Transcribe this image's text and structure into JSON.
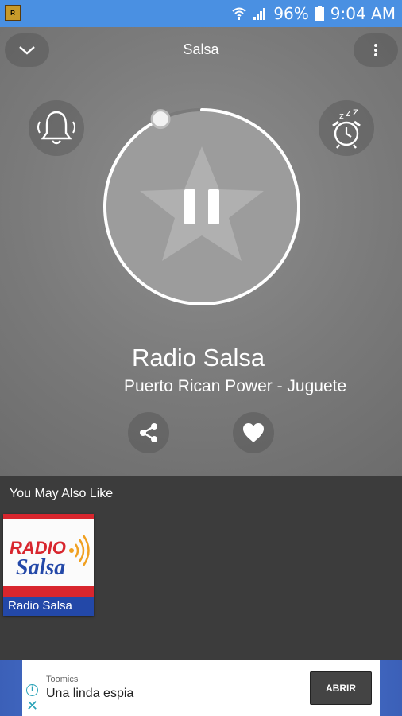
{
  "status_bar": {
    "battery": "96%",
    "time": "9:04 AM",
    "icons": [
      "app-notification-icon",
      "wifi-icon",
      "signal-icon",
      "battery-icon"
    ]
  },
  "player": {
    "title": "Salsa",
    "station_name": "Radio Salsa",
    "track": "Puerto Rican Power - Juguete",
    "progress": 0.93,
    "state": "playing",
    "icons": {
      "collapse": "chevron-down-icon",
      "menu": "more-vert-icon",
      "alarm": "bell-icon",
      "sleep": "sleep-timer-icon",
      "play_pause": "pause-icon",
      "share": "share-icon",
      "favorite": "heart-icon"
    }
  },
  "recommendations": {
    "heading": "You May Also Like",
    "items": [
      {
        "label": "Radio Salsa",
        "logo_text_1": "RADIO",
        "logo_text_2": "Salsa"
      }
    ]
  },
  "ad": {
    "advertiser": "Toomics",
    "headline": "Una linda espia",
    "cta": "ABRIR"
  },
  "colors": {
    "status_bar": "#4a90e2",
    "player_bg": "#7a7a7a",
    "recs_bg": "#3c3c3c",
    "card_label": "#2348a8",
    "ad_accent": "#2aa3b8"
  }
}
